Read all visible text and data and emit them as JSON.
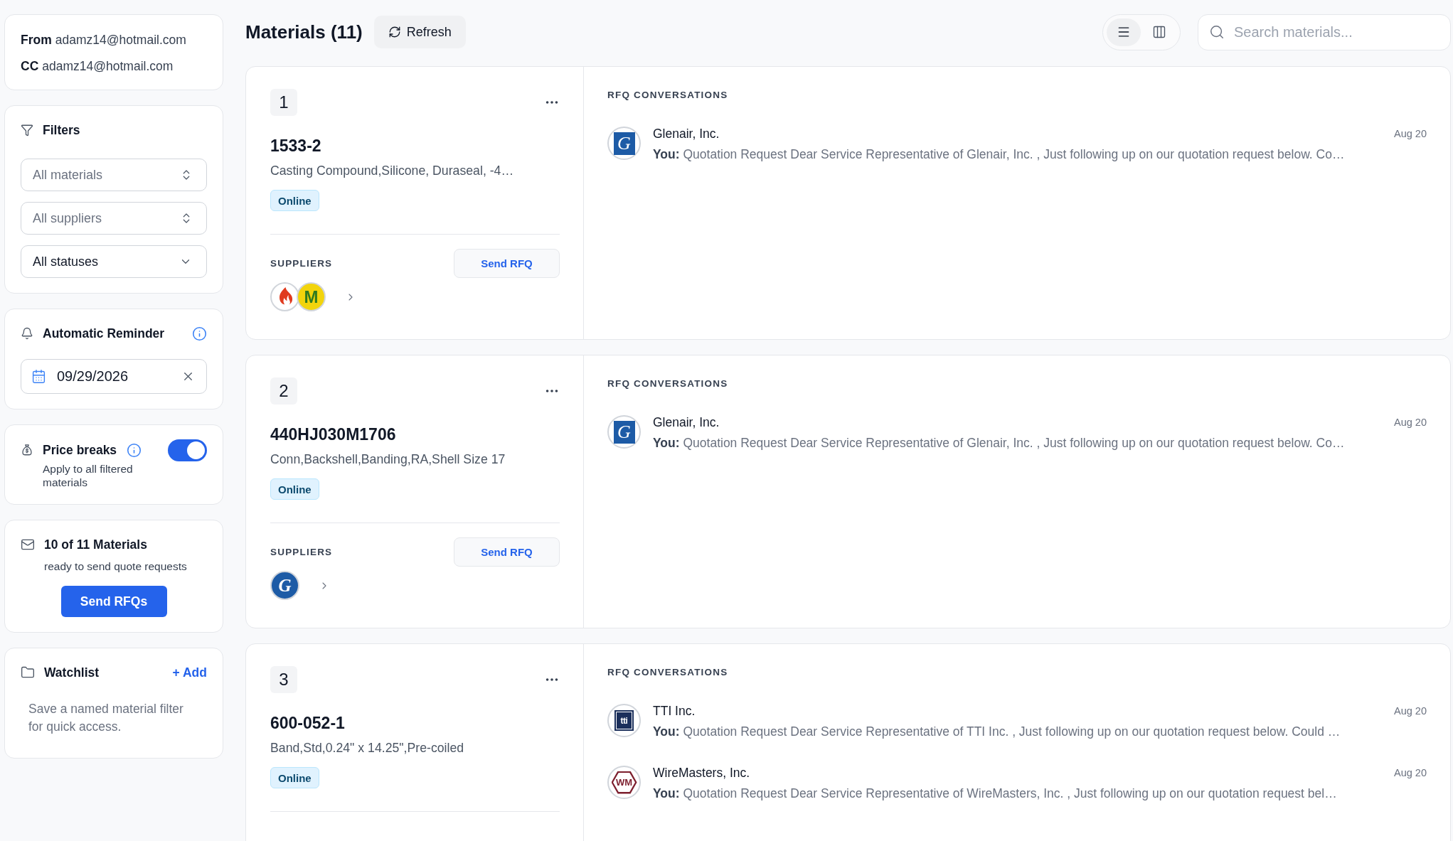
{
  "sender": {
    "from_label": "From",
    "from": "adamz14@hotmail.com",
    "cc_label": "CC",
    "cc": "adamz14@hotmail.com"
  },
  "filters": {
    "title": "Filters",
    "selects": [
      {
        "kind": "combobox",
        "placeholder": "All materials"
      },
      {
        "kind": "combobox",
        "placeholder": "All suppliers"
      },
      {
        "kind": "select",
        "value": "All statuses"
      }
    ]
  },
  "reminder": {
    "title": "Automatic Reminder",
    "date": "09/29/2026"
  },
  "price_breaks": {
    "title": "Price breaks",
    "subtitle": "Apply to all filtered materials",
    "on": true
  },
  "send_summary": {
    "title": "10 of 11 Materials",
    "subtitle": "ready to send quote requests",
    "button": "Send RFQs"
  },
  "watchlist": {
    "title": "Watchlist",
    "add": "+ Add",
    "empty_text": "Save a named material filter for quick access."
  },
  "header": {
    "title": "Materials (11)",
    "refresh": "Refresh",
    "views": [
      {
        "kind": "list",
        "selected": true
      },
      {
        "kind": "columns",
        "selected": false
      }
    ],
    "search": {
      "placeholder": "Search materials..."
    }
  },
  "materials": [
    {
      "number": "1",
      "part": "1533-2",
      "description": "Casting Compound,Silicone, Duraseal, -4…",
      "status": "Online",
      "suppliers_label": "SUPPLIERS",
      "send": "Send RFQ",
      "suppliers": [
        {
          "kind": "flame"
        },
        {
          "kind": "block",
          "text": "M",
          "color": "#f2d40c"
        }
      ],
      "conversations_title": "RFQ CONVERSATIONS",
      "conversations": [
        {
          "logo": {
            "kind": "square",
            "text": "G",
            "color": "#1d5ba6"
          },
          "name": "Glenair, Inc.",
          "date": "Aug 20",
          "message": "**You:** Quotation Request Dear Service Representative of Glenair, Inc. , Just following up on our quotation request below. Co…"
        }
      ]
    },
    {
      "number": "2",
      "part": "440HJ030M1706",
      "description": "Conn,Backshell,Banding,RA,Shell Size 17",
      "status": "Online",
      "suppliers_label": "SUPPLIERS",
      "send": "Send RFQ",
      "suppliers": [
        {
          "kind": "script",
          "text": "G",
          "color": "#1d5ba6"
        }
      ],
      "conversations_title": "RFQ CONVERSATIONS",
      "conversations": [
        {
          "logo": {
            "kind": "square",
            "text": "G",
            "color": "#1d5ba6"
          },
          "name": "Glenair, Inc.",
          "date": "Aug 20",
          "message": "**You:** Quotation Request Dear Service Representative of Glenair, Inc. , Just following up on our quotation request below. Co…"
        }
      ]
    },
    {
      "number": "3",
      "part": "600-052-1",
      "description": "Band,Std,0.24\" x 14.25\",Pre-coiled",
      "status": "Online",
      "conversations_title": "RFQ CONVERSATIONS",
      "conversations": [
        {
          "logo": {
            "kind": "framed",
            "text": "tti",
            "color": "#1b2f5b"
          },
          "name": "TTI Inc.",
          "date": "Aug 20",
          "message": "**You:** Quotation Request Dear Service Representative of TTI Inc. , Just following up on our quotation request below. Could …"
        },
        {
          "logo": {
            "kind": "hexagon",
            "text": "WM",
            "color": "#7d1f2e"
          },
          "name": "WireMasters, Inc.",
          "date": "Aug 20",
          "message": "**You:** Quotation Request Dear Service Representative of WireMasters, Inc. , Just following up on our quotation request bel…"
        }
      ]
    }
  ]
}
